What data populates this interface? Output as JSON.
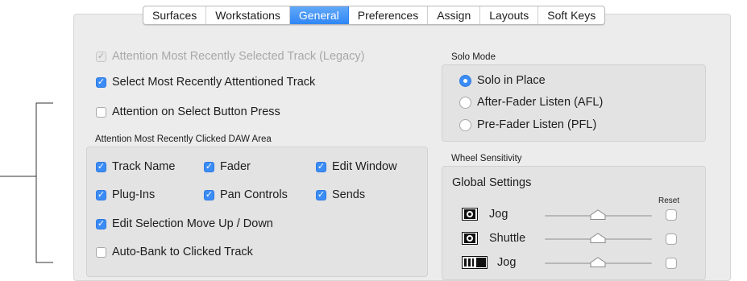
{
  "tabs": [
    {
      "label": "Surfaces",
      "active": false
    },
    {
      "label": "Workstations",
      "active": false
    },
    {
      "label": "General",
      "active": true
    },
    {
      "label": "Preferences",
      "active": false
    },
    {
      "label": "Assign",
      "active": false
    },
    {
      "label": "Layouts",
      "active": false
    },
    {
      "label": "Soft Keys",
      "active": false
    }
  ],
  "left": {
    "legacy": {
      "label": "Attention Most Recently Selected Track (Legacy)",
      "checked": true,
      "enabled": false
    },
    "select_recent": {
      "label": "Select Most Recently Attentioned Track",
      "checked": true
    },
    "select_button": {
      "label": "Attention on Select Button Press",
      "checked": false
    },
    "daw_area": {
      "title": "Attention Most Recently Clicked DAW Area",
      "track_name": {
        "label": "Track Name",
        "checked": true
      },
      "fader": {
        "label": "Fader",
        "checked": true
      },
      "edit_window": {
        "label": "Edit Window",
        "checked": true
      },
      "plugins": {
        "label": "Plug-Ins",
        "checked": true
      },
      "pan_controls": {
        "label": "Pan Controls",
        "checked": true
      },
      "sends": {
        "label": "Sends",
        "checked": true
      },
      "edit_selection": {
        "label": "Edit Selection Move Up / Down",
        "checked": true
      },
      "auto_bank": {
        "label": "Auto-Bank to Clicked Track",
        "checked": false
      }
    }
  },
  "solo_mode": {
    "title": "Solo Mode",
    "options": [
      "Solo in Place",
      "After-Fader Listen (AFL)",
      "Pre-Fader Listen (PFL)"
    ],
    "selected": "Solo in Place"
  },
  "wheel": {
    "title": "Wheel Sensitivity",
    "global_title": "Global Settings",
    "reset_label": "Reset",
    "rows": [
      {
        "icon": "jog-wheel-icon",
        "label": "Jog",
        "level": 0.5
      },
      {
        "icon": "shuttle-wheel-icon",
        "label": "Shuttle",
        "level": 0.5
      },
      {
        "icon": "fader-jog-icon",
        "label": "Jog",
        "level": 0.5
      }
    ]
  },
  "colors": {
    "accent": "#3b8cf5",
    "panel": "#ececec",
    "group_box": "#e3e3e3"
  }
}
